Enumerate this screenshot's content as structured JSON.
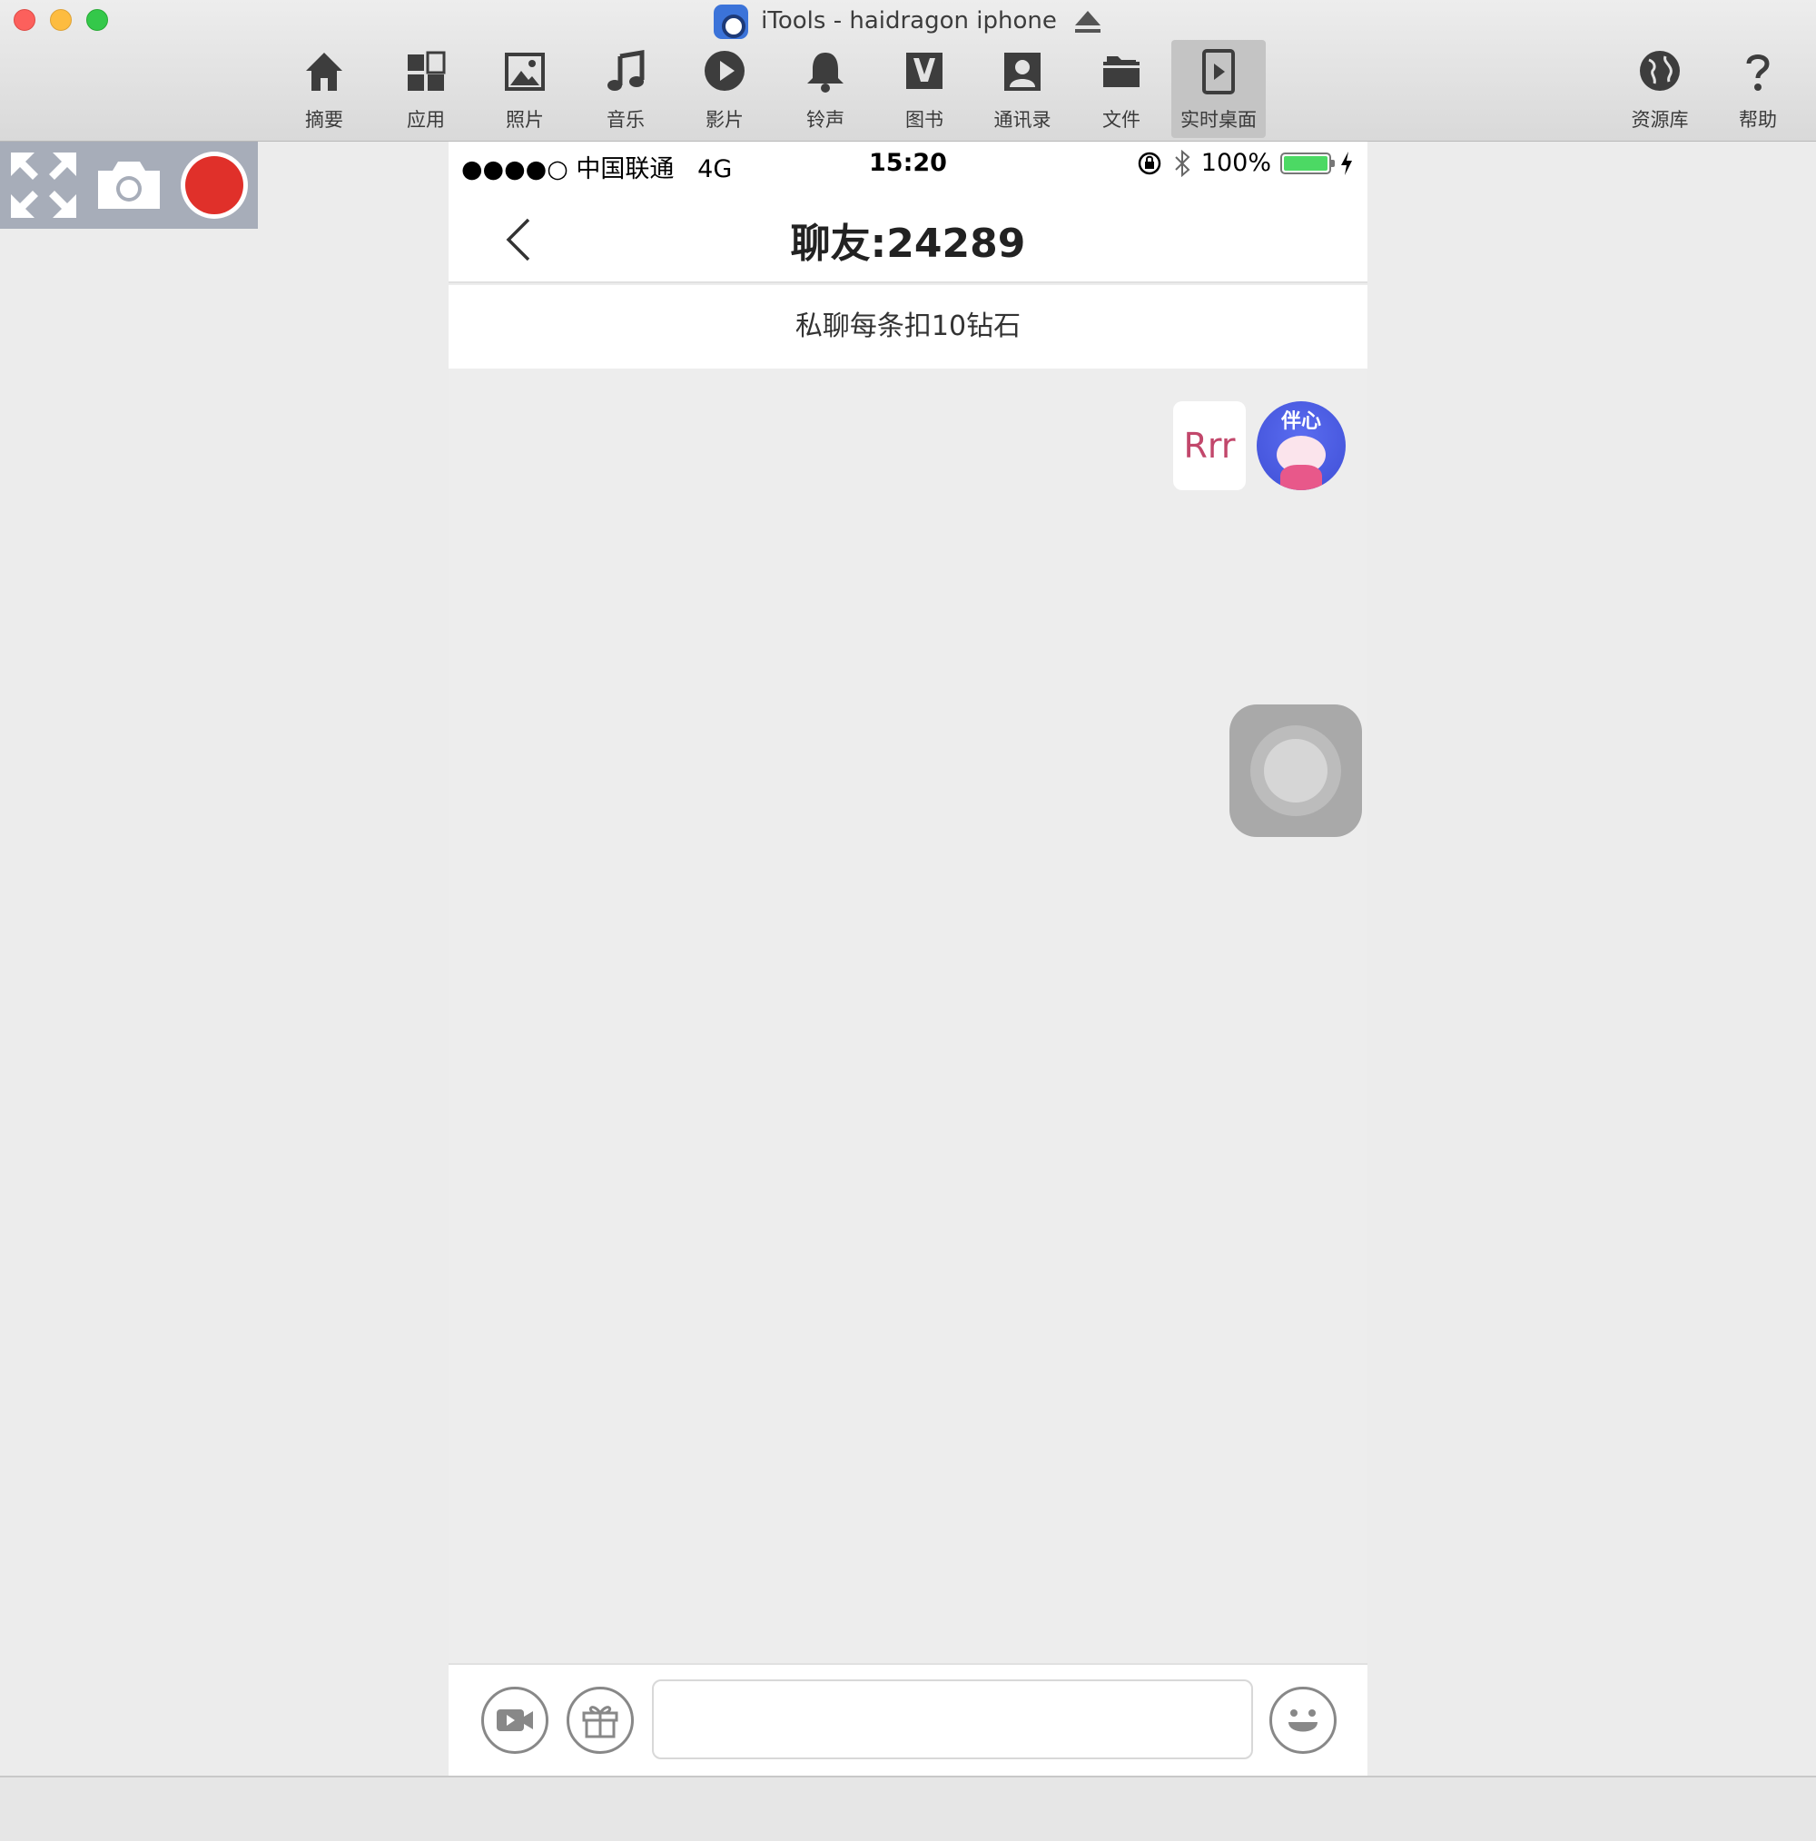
{
  "window": {
    "title": "iTools - haidragon iphone"
  },
  "toolbar": {
    "items": [
      {
        "label": "摘要",
        "icon": "home-icon"
      },
      {
        "label": "应用",
        "icon": "apps-icon"
      },
      {
        "label": "照片",
        "icon": "photo-icon"
      },
      {
        "label": "音乐",
        "icon": "music-icon"
      },
      {
        "label": "影片",
        "icon": "play-icon"
      },
      {
        "label": "铃声",
        "icon": "bell-icon"
      },
      {
        "label": "图书",
        "icon": "book-icon"
      },
      {
        "label": "通讯录",
        "icon": "contacts-icon"
      },
      {
        "label": "文件",
        "icon": "folder-icon"
      },
      {
        "label": "实时桌面",
        "icon": "live-desktop-icon"
      }
    ],
    "right_items": [
      {
        "label": "资源库",
        "icon": "globe-icon"
      },
      {
        "label": "帮助",
        "icon": "help-icon"
      }
    ]
  },
  "phone": {
    "statusbar": {
      "carrier": "●●●●○ 中国联通",
      "network": "4G",
      "time": "15:20",
      "battery": "100%"
    },
    "nav": {
      "title": "聊友:24289"
    },
    "notice": "私聊每条扣10钻石",
    "message": {
      "text": "Rrr",
      "avatar_text": "伴心"
    },
    "input": {
      "placeholder": ""
    }
  },
  "colors": {
    "record": "#e0302a",
    "battery": "#4cd964",
    "message_text": "#c2476b",
    "avatar": "#4a5ae6"
  }
}
